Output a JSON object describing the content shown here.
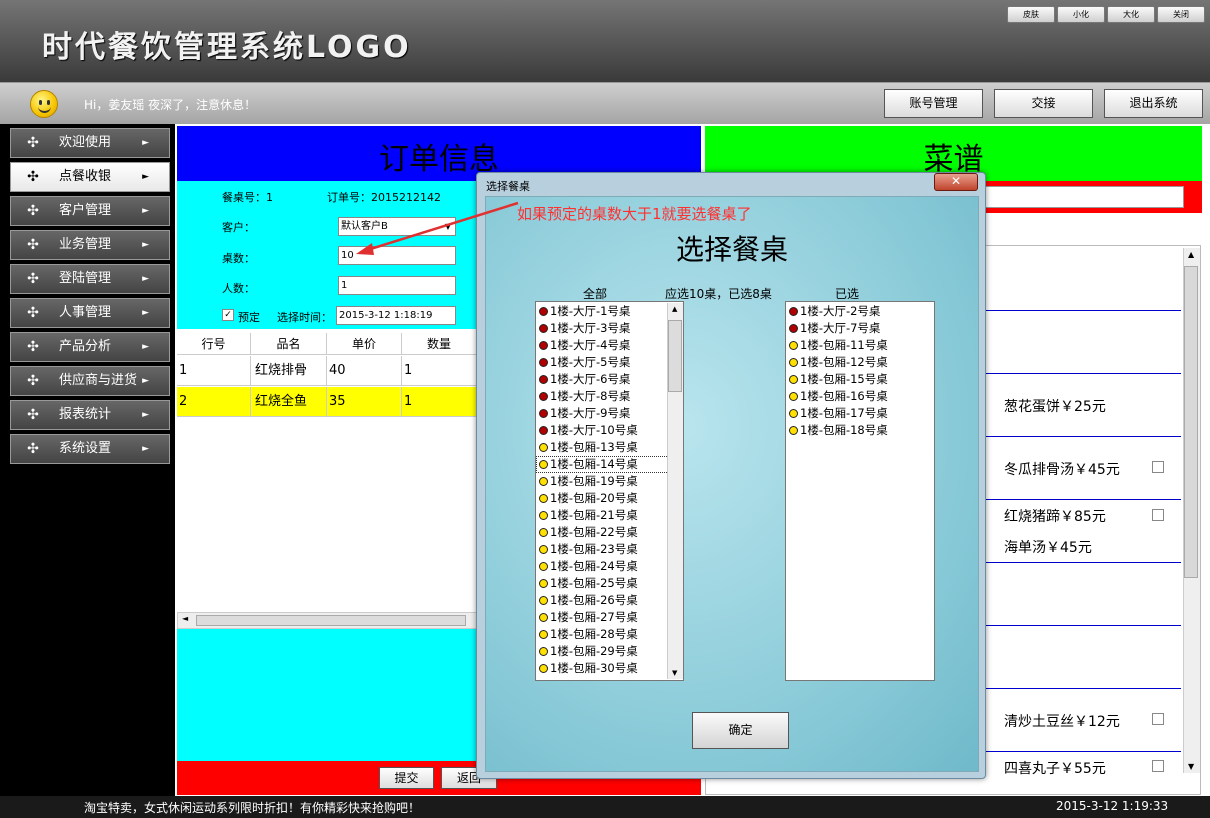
{
  "app": {
    "logo_text": "时代餐饮管理系统LOGO",
    "window_buttons": [
      "皮肤",
      "小化",
      "大化",
      "关闭"
    ]
  },
  "userbar": {
    "greeting": "Hi，姜友瑶  夜深了，注意休息！",
    "buttons": [
      "账号管理",
      "交接",
      "退出系统"
    ]
  },
  "sidebar": {
    "items": [
      {
        "label": "欢迎使用"
      },
      {
        "label": "点餐收银"
      },
      {
        "label": "客户管理"
      },
      {
        "label": "业务管理"
      },
      {
        "label": "登陆管理"
      },
      {
        "label": "人事管理"
      },
      {
        "label": "产品分析"
      },
      {
        "label": "供应商与进货"
      },
      {
        "label": "报表统计"
      },
      {
        "label": "系统设置"
      }
    ],
    "active_index": 1,
    "arrow": "►"
  },
  "order": {
    "title": "订单信息",
    "table_no_label": "餐桌号：1",
    "order_no_label": "订单号：2015212142",
    "customer_label": "客户：",
    "customer_value": "默认客户B",
    "tables_label": "桌数：",
    "tables_value": "10",
    "people_label": "人数：",
    "people_value": "1",
    "reserve_label": "预定",
    "time_label": "选择时间：",
    "time_value": "2015-3-12  1:18:19",
    "columns": [
      "行号",
      "品名",
      "单价",
      "数量"
    ],
    "rows": [
      [
        "1",
        "红烧排骨",
        "40",
        "1"
      ],
      [
        "2",
        "红烧全鱼",
        "35",
        "1"
      ]
    ],
    "submit_label": "提交",
    "back_label": "返回"
  },
  "menu": {
    "title": "菜谱",
    "dishes": [
      {
        "name": "葱花蛋饼￥25元"
      },
      {
        "name": "冬瓜排骨汤￥45元"
      },
      {
        "name": "红烧猪蹄￥85元"
      },
      {
        "name": "海单汤￥45元"
      },
      {
        "name": "清炒土豆丝￥12元"
      },
      {
        "name": "四喜丸子￥55元"
      }
    ]
  },
  "dialog": {
    "window_title": "选择餐桌",
    "annotation": "如果预定的桌数大于1就要选餐桌了",
    "heading": "选择餐桌",
    "all_label": "全部",
    "count_label": "应选10桌，已选8桌",
    "selected_label": "已选",
    "ok_label": "确定",
    "all_tables": [
      {
        "name": "1楼-大厅-1号桌",
        "status": "red"
      },
      {
        "name": "1楼-大厅-3号桌",
        "status": "red"
      },
      {
        "name": "1楼-大厅-4号桌",
        "status": "red"
      },
      {
        "name": "1楼-大厅-5号桌",
        "status": "red"
      },
      {
        "name": "1楼-大厅-6号桌",
        "status": "red"
      },
      {
        "name": "1楼-大厅-8号桌",
        "status": "red"
      },
      {
        "name": "1楼-大厅-9号桌",
        "status": "red"
      },
      {
        "name": "1楼-大厅-10号桌",
        "status": "red"
      },
      {
        "name": "1楼-包厢-13号桌",
        "status": "yellow"
      },
      {
        "name": "1楼-包厢-14号桌",
        "status": "yellow"
      },
      {
        "name": "1楼-包厢-19号桌",
        "status": "yellow"
      },
      {
        "name": "1楼-包厢-20号桌",
        "status": "yellow"
      },
      {
        "name": "1楼-包厢-21号桌",
        "status": "yellow"
      },
      {
        "name": "1楼-包厢-22号桌",
        "status": "yellow"
      },
      {
        "name": "1楼-包厢-23号桌",
        "status": "yellow"
      },
      {
        "name": "1楼-包厢-24号桌",
        "status": "yellow"
      },
      {
        "name": "1楼-包厢-25号桌",
        "status": "yellow"
      },
      {
        "name": "1楼-包厢-26号桌",
        "status": "yellow"
      },
      {
        "name": "1楼-包厢-27号桌",
        "status": "yellow"
      },
      {
        "name": "1楼-包厢-28号桌",
        "status": "yellow"
      },
      {
        "name": "1楼-包厢-29号桌",
        "status": "yellow"
      },
      {
        "name": "1楼-包厢-30号桌",
        "status": "yellow"
      }
    ],
    "focused_index": 9,
    "selected_tables": [
      {
        "name": "1楼-大厅-2号桌",
        "status": "red"
      },
      {
        "name": "1楼-大厅-7号桌",
        "status": "red"
      },
      {
        "name": "1楼-包厢-11号桌",
        "status": "yellow"
      },
      {
        "name": "1楼-包厢-12号桌",
        "status": "yellow"
      },
      {
        "name": "1楼-包厢-15号桌",
        "status": "yellow"
      },
      {
        "name": "1楼-包厢-16号桌",
        "status": "yellow"
      },
      {
        "name": "1楼-包厢-17号桌",
        "status": "yellow"
      },
      {
        "name": "1楼-包厢-18号桌",
        "status": "yellow"
      }
    ]
  },
  "statusbar": {
    "promo": "淘宝特卖，女式休闲运动系列限时折扣！有你精彩快来抢购吧！",
    "datetime": "2015-3-12  1:19:33"
  },
  "colors": {
    "order_header": "#0000ff",
    "order_form": "#00ffff",
    "menu_header": "#00ff00",
    "accent_red": "#ff0000",
    "highlight_row": "#ffff00",
    "status_red": "#b00000",
    "status_yellow": "#ffe000"
  },
  "icons": {
    "smiley": "smiley-face-icon",
    "nav": "move-arrows-icon",
    "close": "close-icon",
    "checkbox": "checkbox-icon"
  }
}
